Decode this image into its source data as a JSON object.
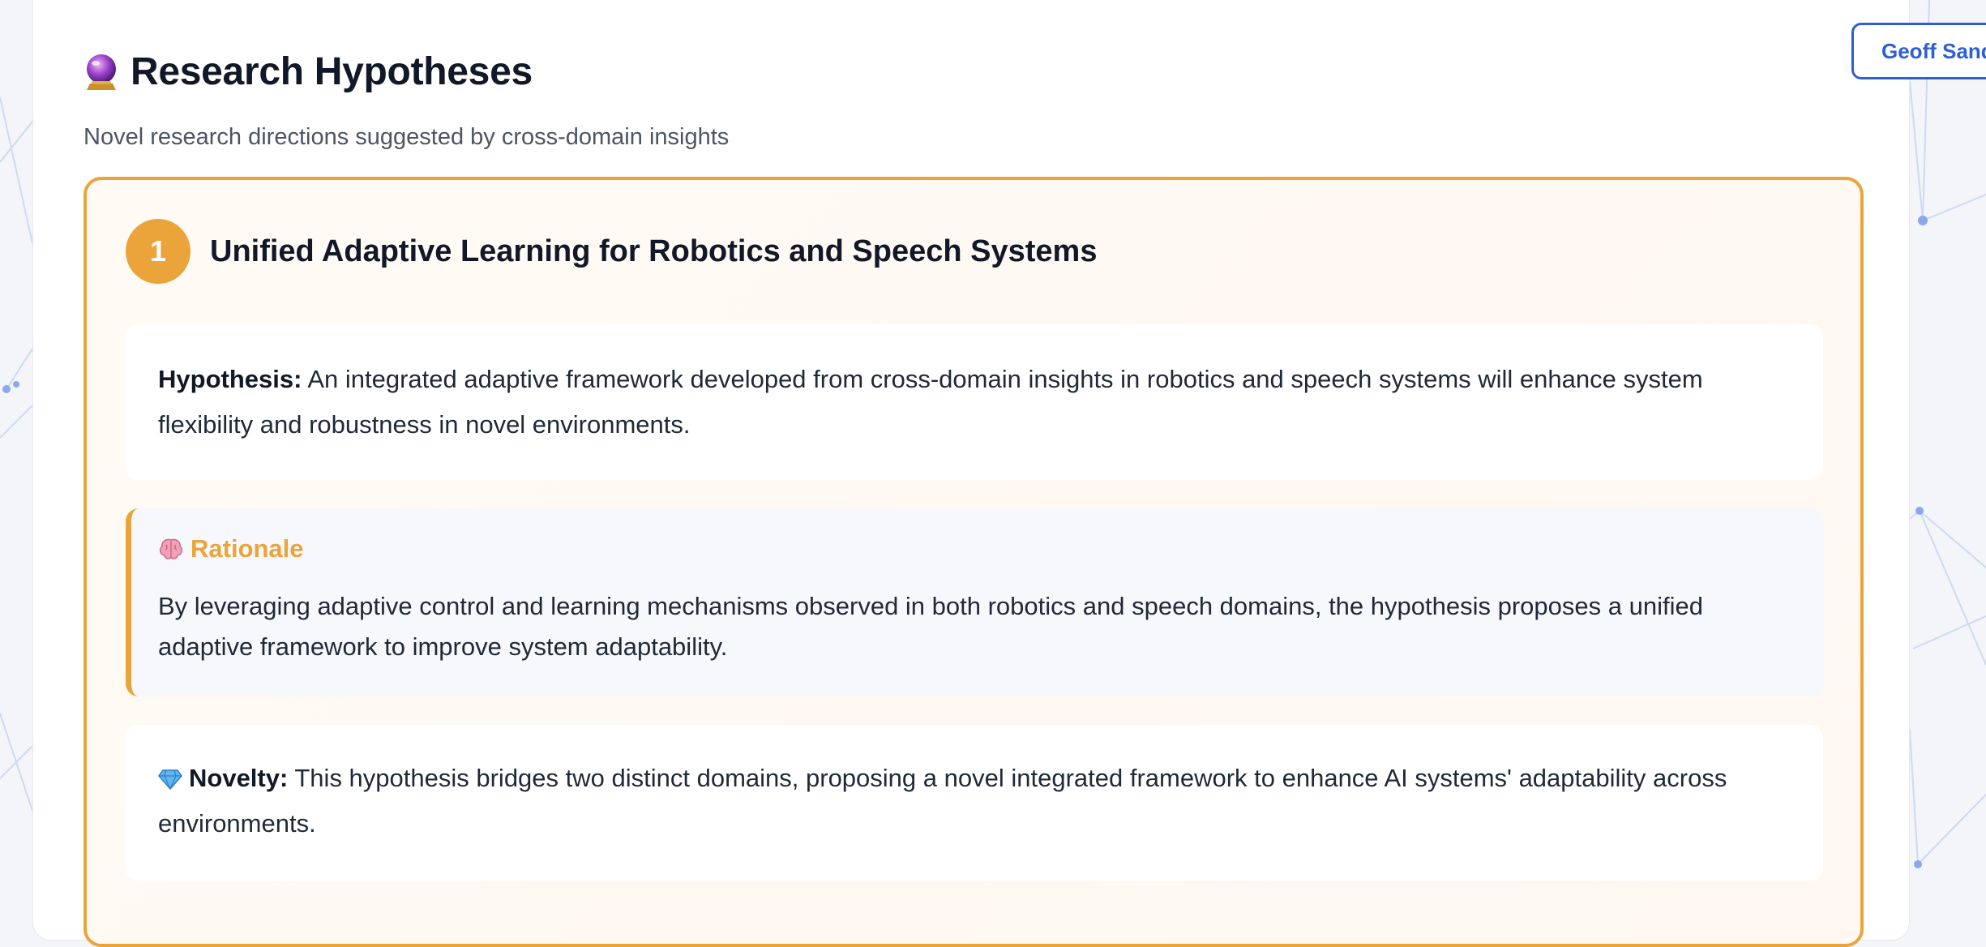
{
  "header": {
    "title": "Research Hypotheses",
    "title_icon": "crystal-ball-icon",
    "subtitle": "Novel research directions suggested by cross-domain insights",
    "user_button_label": "Geoff Sanders"
  },
  "hypotheses": [
    {
      "number": "1",
      "title": "Unified Adaptive Learning for Robotics and Speech Systems",
      "hypothesis_label": "Hypothesis:",
      "hypothesis_text": "An integrated adaptive framework developed from cross-domain insights in robotics and speech systems will enhance system flexibility and robustness in novel environments.",
      "rationale_label": "Rationale",
      "rationale_icon": "brain-icon",
      "rationale_text": "By leveraging adaptive control and learning mechanisms observed in both robotics and speech domains, the hypothesis proposes a unified adaptive framework to improve system adaptability.",
      "novelty_label": "Novelty:",
      "novelty_icon": "gem-icon",
      "novelty_text": "This hypothesis bridges two distinct domains, proposing a novel integrated framework to enhance AI systems' adaptability across environments."
    }
  ],
  "colors": {
    "accent": "#eba43a",
    "link_blue": "#2f5fd6",
    "text_dark": "#111827",
    "text_muted": "#4b5563"
  }
}
